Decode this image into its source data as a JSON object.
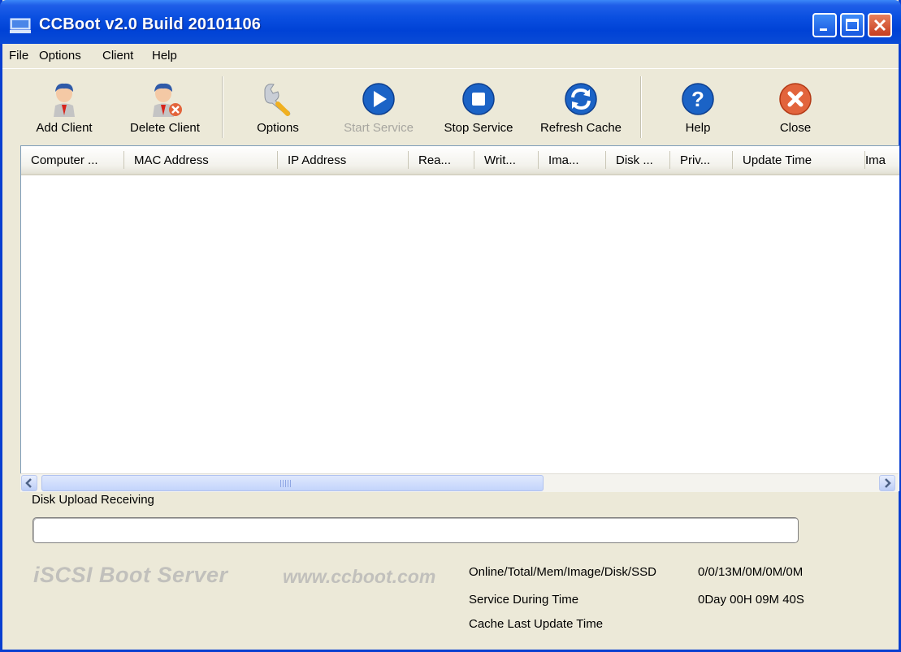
{
  "window": {
    "title": "CCBoot v2.0 Build 20101106"
  },
  "menu": [
    "File",
    "Options",
    "Client",
    "Help"
  ],
  "toolbar": [
    {
      "label": "Add Client",
      "icon": "add-client-icon",
      "enabled": true
    },
    {
      "label": "Delete Client",
      "icon": "delete-client-icon",
      "enabled": true
    },
    {
      "label": "Options",
      "icon": "wrench-icon",
      "enabled": true
    },
    {
      "label": "Start Service",
      "icon": "play-icon",
      "enabled": false
    },
    {
      "label": "Stop Service",
      "icon": "stop-icon",
      "enabled": true
    },
    {
      "label": "Refresh Cache",
      "icon": "refresh-icon",
      "enabled": true
    },
    {
      "label": "Help",
      "icon": "help-icon",
      "enabled": true
    },
    {
      "label": "Close",
      "icon": "close-icon",
      "enabled": true
    }
  ],
  "table": {
    "columns": [
      "Computer ...",
      "MAC Address",
      "IP Address",
      "Rea...",
      "Writ...",
      "Ima...",
      "Disk ...",
      "Priv...",
      "Update Time",
      "Ima"
    ],
    "rows": []
  },
  "disk_upload": {
    "label": "Disk Upload Receiving"
  },
  "branding": {
    "product": "iSCSI Boot Server",
    "url": "www.ccboot.com"
  },
  "stats": {
    "online_label": "Online/Total/Mem/Image/Disk/SSD",
    "online_value": "0/0/13M/0M/0M/0M",
    "service_label": "Service During Time",
    "service_value": "0Day 00H 09M 40S",
    "cache_label": "Cache Last Update Time",
    "cache_value": ""
  },
  "colors": {
    "titlebar": "#0a4fe0",
    "window_bg": "#ece9d8",
    "close_button": "#e2643c",
    "brand_text": "#c1c0bc"
  }
}
